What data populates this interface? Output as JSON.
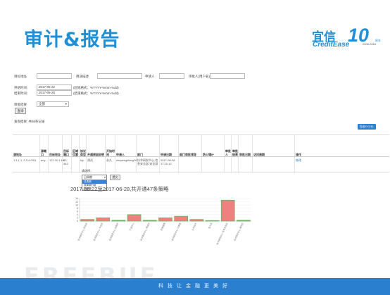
{
  "slide": {
    "title": "审计&报告",
    "footer": "科技让金融更美好",
    "watermark": "FREEBUF"
  },
  "logo": {
    "cn": "宜信",
    "en": "CreditEase",
    "ten": "10",
    "years": "2006-2016",
    "badge": "周年"
  },
  "filters": {
    "row1": [
      {
        "label": "目标地址",
        "value": ""
      },
      {
        "label": "用途描述",
        "value": ""
      },
      {
        "label": "申请人",
        "value": ""
      },
      {
        "label": "审批人(用户名)",
        "value": ""
      }
    ],
    "start_label": "开始时间：",
    "start_value": "2017-06-22",
    "start_hint": "(起始格式：%YYYY-%mm-%dd)",
    "end_label": "结束时间：",
    "end_value": "2017-06-28",
    "end_hint": "(结束格式：%YYYY-%mm-%dd)",
    "status_label": "审批结果",
    "status_value": "全部",
    "query_button": "查询",
    "result_text": "查询结果: 共56条记录"
  },
  "table": {
    "export_button": "导出EXCEL",
    "headers": [
      "源地址",
      "源端口",
      "目标地址",
      "目标端口",
      "区域位置",
      "协议类型",
      "开通原因说明",
      "开始时间",
      "申请人",
      "部门",
      "申请日期",
      "部门审批领导",
      "防火墙IP",
      "审批人",
      "审批结果",
      "审批日期",
      "访问周期",
      "操作"
    ],
    "row": [
      "1.1.1.1, 2.3.4.0/24",
      "any",
      "172.10.1.10",
      "80, 443",
      "",
      "tcp",
      "测试",
      "永久",
      "zhupengxiang16",
      "技术研发中心-信息安全部-安全部",
      "2017-06-28 17:10:12",
      "",
      "",
      "",
      "",
      "",
      "",
      "修改"
    ]
  },
  "chart_control": {
    "label": "请选择：",
    "selected": "日周期",
    "options": [
      "日周期",
      "按周期分组",
      "按月期"
    ],
    "button": "提交"
  },
  "chart_data": {
    "type": "bar",
    "title": "2017-06-22至2017-06-28,共开通47条策略",
    "ylim": [
      0,
      14
    ],
    "yticks": [
      0,
      2,
      4,
      6,
      8,
      10,
      12,
      14
    ],
    "categories": [
      "技术研发中心-安全部",
      "技术研发中心-平台部",
      "技术研发中心-运维部",
      "产品中心",
      "技术研发中心-测试部",
      "财富管理",
      "技术研发中心-大数据",
      "公共技术",
      "宜人贷",
      "技术研发中心-信息安全部",
      "技术研发中心-架构部"
    ],
    "values": [
      1,
      2,
      0.5,
      4,
      0.5,
      2,
      3,
      1,
      0.3,
      13,
      0.5
    ],
    "bar_color": "#f08080",
    "bar_edge_color": "#5cb85c"
  }
}
